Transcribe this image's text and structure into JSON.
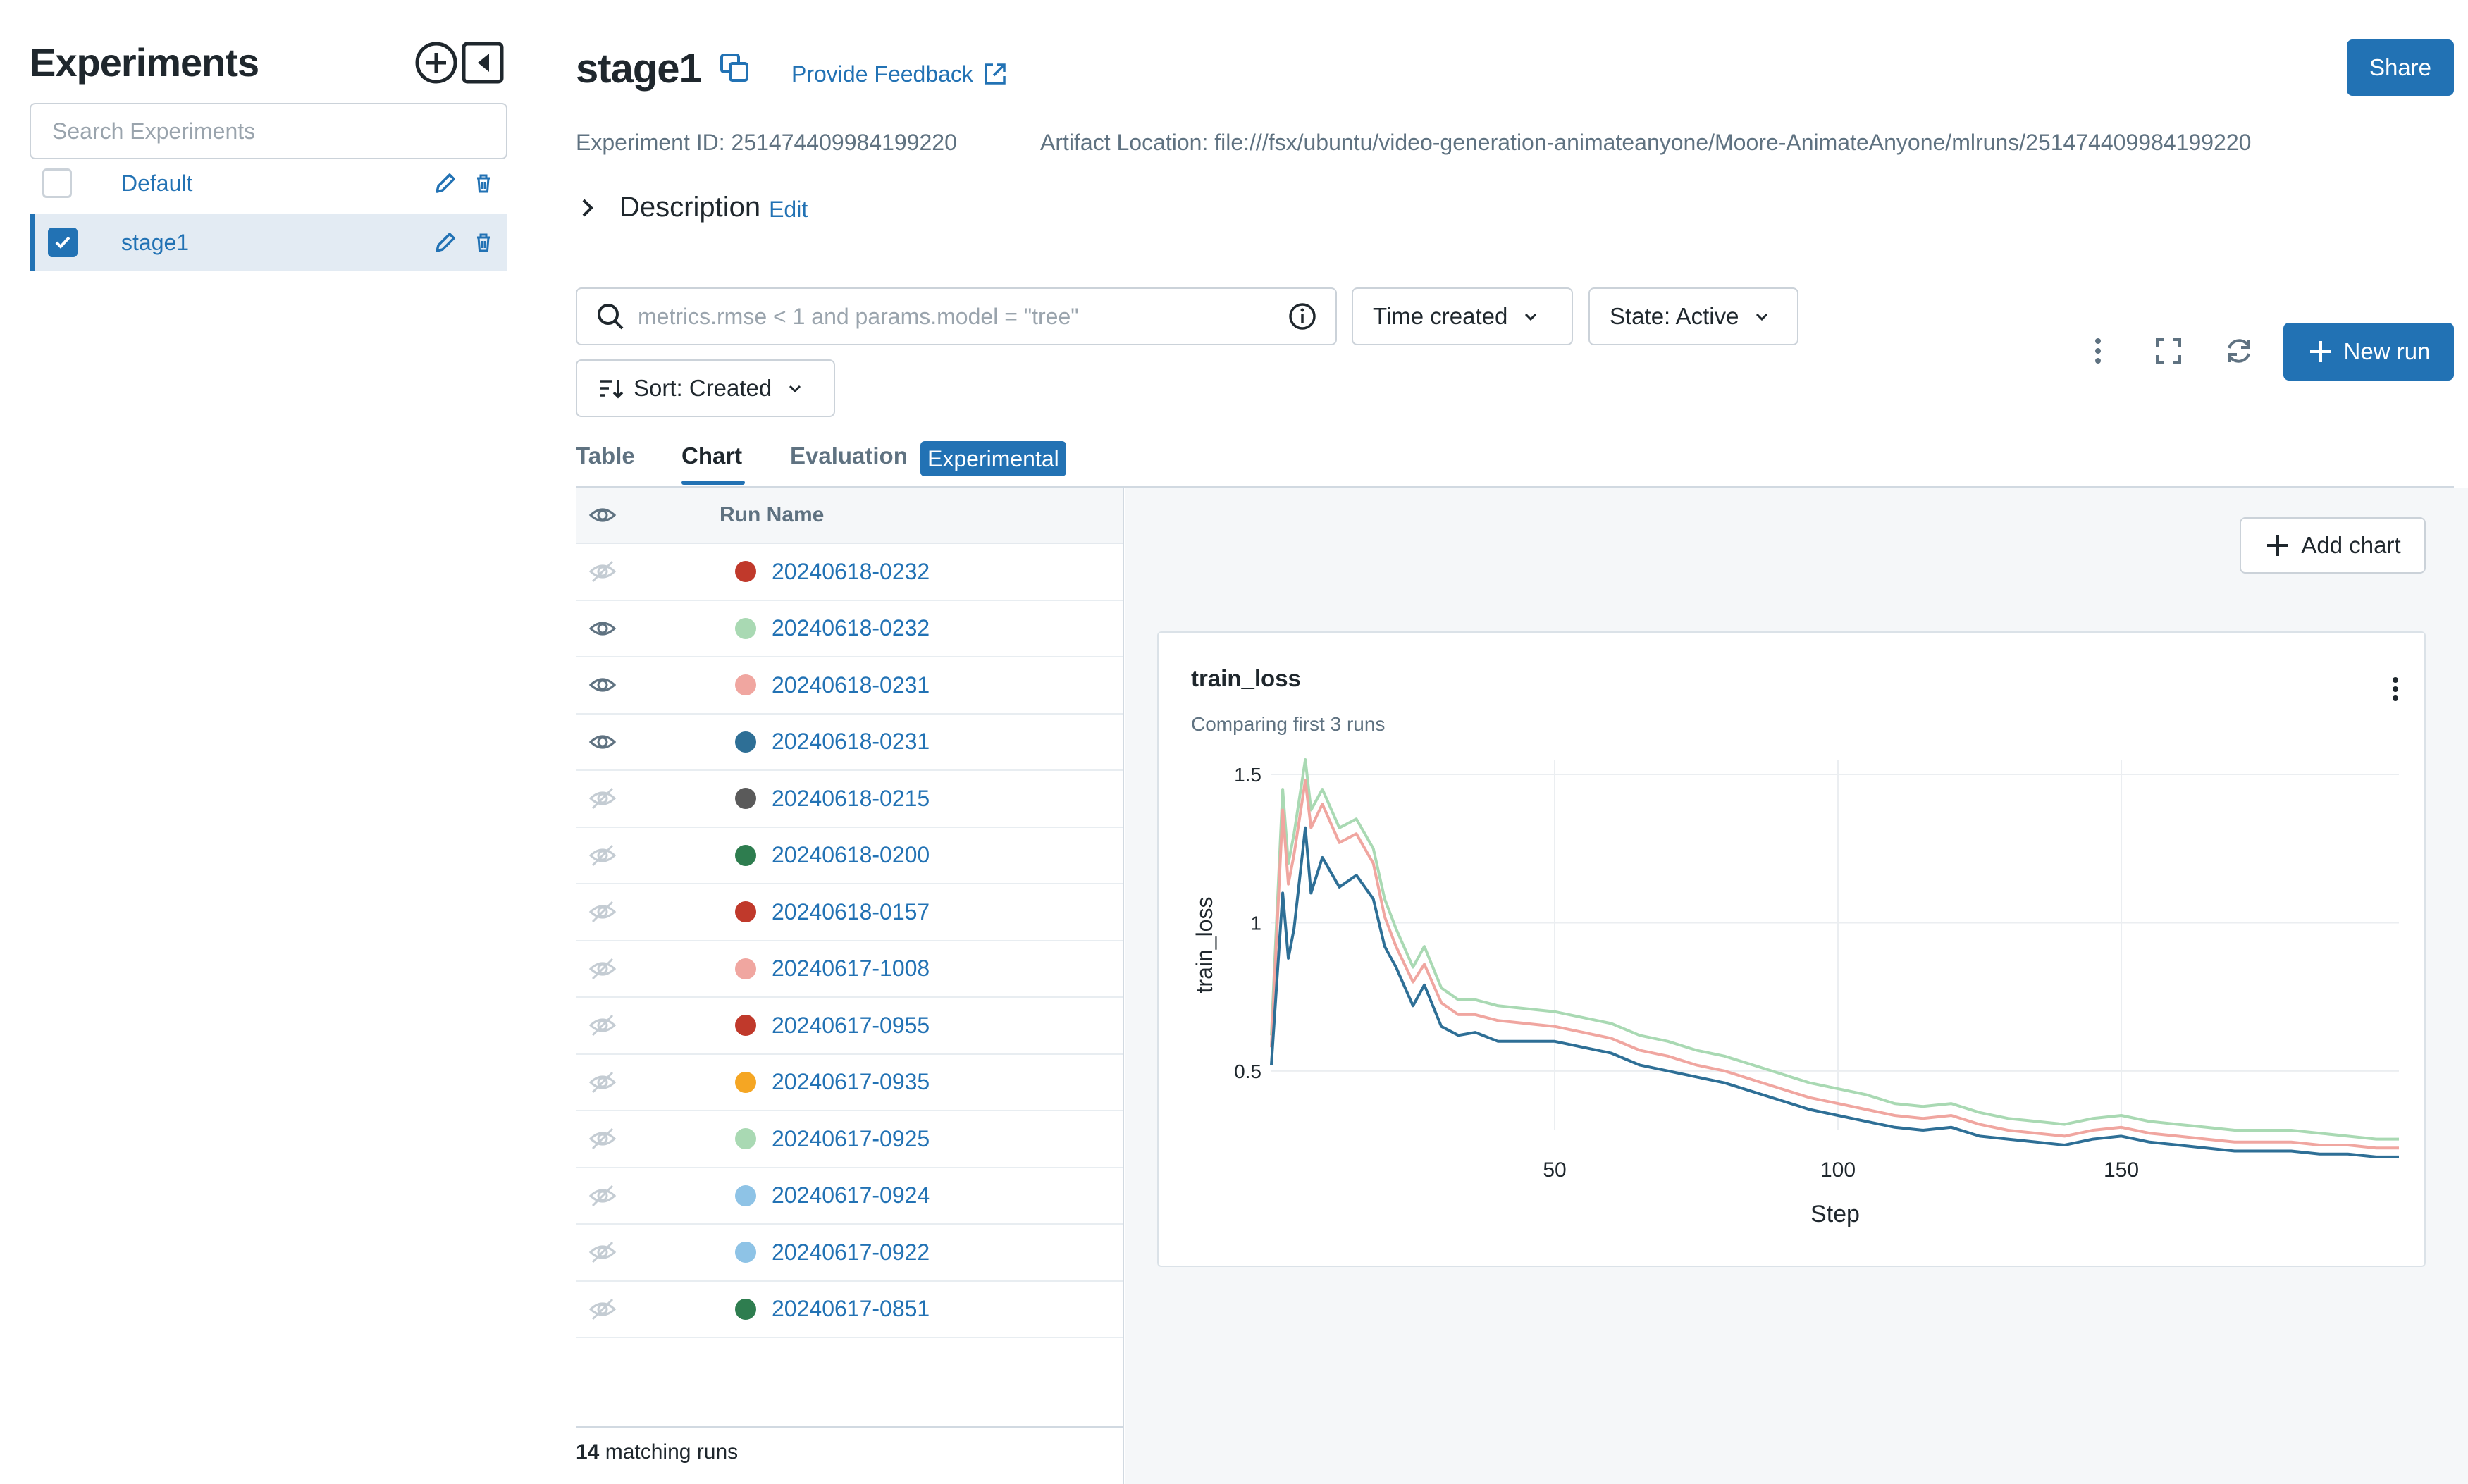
{
  "sidebar": {
    "title": "Experiments",
    "search_placeholder": "Search Experiments",
    "items": [
      {
        "label": "Default",
        "checked": false
      },
      {
        "label": "stage1",
        "checked": true
      }
    ]
  },
  "header": {
    "title": "stage1",
    "feedback": "Provide Feedback",
    "share": "Share",
    "experiment_id": "Experiment ID: 251474409984199220",
    "artifact_location": "Artifact Location: file:///fsx/ubuntu/video-generation-animateanyone/Moore-AnimateAnyone/mlruns/251474409984199220",
    "description": "Description",
    "edit": "Edit"
  },
  "controls": {
    "search_placeholder": "metrics.rmse < 1 and params.model = \"tree\"",
    "time_created": "Time created",
    "state": "State: Active",
    "sort": "Sort: Created",
    "new_run": "New run"
  },
  "tabs": {
    "table": "Table",
    "chart": "Chart",
    "evaluation": "Evaluation",
    "experimental": "Experimental"
  },
  "runs": {
    "header": "Run Name",
    "rows": [
      {
        "name": "20240618-0232",
        "color": "#c0392b",
        "visible": false
      },
      {
        "name": "20240618-0232",
        "color": "#a9d9b3",
        "visible": true
      },
      {
        "name": "20240618-0231",
        "color": "#f0a6a0",
        "visible": true
      },
      {
        "name": "20240618-0231",
        "color": "#2e6f96",
        "visible": true
      },
      {
        "name": "20240618-0215",
        "color": "#5a5a5a",
        "visible": false
      },
      {
        "name": "20240618-0200",
        "color": "#2e7d4f",
        "visible": false
      },
      {
        "name": "20240618-0157",
        "color": "#c0392b",
        "visible": false
      },
      {
        "name": "20240617-1008",
        "color": "#f0a6a0",
        "visible": false
      },
      {
        "name": "20240617-0955",
        "color": "#c0392b",
        "visible": false
      },
      {
        "name": "20240617-0935",
        "color": "#f5a623",
        "visible": false
      },
      {
        "name": "20240617-0925",
        "color": "#a9d9b3",
        "visible": false
      },
      {
        "name": "20240617-0924",
        "color": "#8ec3e6",
        "visible": false
      },
      {
        "name": "20240617-0922",
        "color": "#8ec3e6",
        "visible": false
      },
      {
        "name": "20240617-0851",
        "color": "#2e7d4f",
        "visible": false
      }
    ],
    "count": "14",
    "count_suffix": " matching runs"
  },
  "chart_panel": {
    "add_chart": "Add chart",
    "card_title": "train_loss",
    "card_subtitle": "Comparing first 3 runs"
  },
  "chart_data": {
    "type": "line",
    "title": "train_loss",
    "xlabel": "Step",
    "ylabel": "train_loss",
    "xlim": [
      0,
      199
    ],
    "ylim": [
      0.3,
      1.55
    ],
    "xticks": [
      50,
      100,
      150
    ],
    "yticks": [
      0.5,
      1,
      1.5
    ],
    "grid": true,
    "series": [
      {
        "color": "#a9d9b3",
        "points": [
          [
            0,
            0.62
          ],
          [
            2,
            1.45
          ],
          [
            3,
            1.2
          ],
          [
            4,
            1.3
          ],
          [
            6,
            1.55
          ],
          [
            7,
            1.38
          ],
          [
            9,
            1.45
          ],
          [
            12,
            1.32
          ],
          [
            15,
            1.35
          ],
          [
            18,
            1.25
          ],
          [
            20,
            1.08
          ],
          [
            22,
            0.98
          ],
          [
            25,
            0.85
          ],
          [
            27,
            0.92
          ],
          [
            30,
            0.78
          ],
          [
            33,
            0.74
          ],
          [
            36,
            0.74
          ],
          [
            40,
            0.72
          ],
          [
            45,
            0.71
          ],
          [
            50,
            0.7
          ],
          [
            55,
            0.68
          ],
          [
            60,
            0.66
          ],
          [
            65,
            0.62
          ],
          [
            70,
            0.6
          ],
          [
            75,
            0.57
          ],
          [
            80,
            0.55
          ],
          [
            85,
            0.52
          ],
          [
            90,
            0.49
          ],
          [
            95,
            0.46
          ],
          [
            100,
            0.44
          ],
          [
            105,
            0.42
          ],
          [
            110,
            0.39
          ],
          [
            115,
            0.38
          ],
          [
            120,
            0.39
          ],
          [
            125,
            0.36
          ],
          [
            130,
            0.34
          ],
          [
            135,
            0.33
          ],
          [
            140,
            0.32
          ],
          [
            145,
            0.34
          ],
          [
            150,
            0.35
          ],
          [
            155,
            0.33
          ],
          [
            160,
            0.32
          ],
          [
            165,
            0.31
          ],
          [
            170,
            0.3
          ],
          [
            175,
            0.3
          ],
          [
            180,
            0.3
          ],
          [
            185,
            0.29
          ],
          [
            190,
            0.28
          ],
          [
            195,
            0.27
          ],
          [
            199,
            0.27
          ]
        ]
      },
      {
        "color": "#f0a6a0",
        "points": [
          [
            0,
            0.58
          ],
          [
            2,
            1.38
          ],
          [
            3,
            1.13
          ],
          [
            4,
            1.23
          ],
          [
            6,
            1.48
          ],
          [
            7,
            1.32
          ],
          [
            9,
            1.4
          ],
          [
            12,
            1.27
          ],
          [
            15,
            1.3
          ],
          [
            18,
            1.2
          ],
          [
            20,
            1.02
          ],
          [
            22,
            0.92
          ],
          [
            25,
            0.8
          ],
          [
            27,
            0.86
          ],
          [
            30,
            0.73
          ],
          [
            33,
            0.69
          ],
          [
            36,
            0.69
          ],
          [
            40,
            0.67
          ],
          [
            45,
            0.66
          ],
          [
            50,
            0.65
          ],
          [
            55,
            0.63
          ],
          [
            60,
            0.61
          ],
          [
            65,
            0.57
          ],
          [
            70,
            0.55
          ],
          [
            75,
            0.52
          ],
          [
            80,
            0.5
          ],
          [
            85,
            0.47
          ],
          [
            90,
            0.44
          ],
          [
            95,
            0.41
          ],
          [
            100,
            0.39
          ],
          [
            105,
            0.37
          ],
          [
            110,
            0.35
          ],
          [
            115,
            0.34
          ],
          [
            120,
            0.35
          ],
          [
            125,
            0.32
          ],
          [
            130,
            0.3
          ],
          [
            135,
            0.29
          ],
          [
            140,
            0.28
          ],
          [
            145,
            0.3
          ],
          [
            150,
            0.31
          ],
          [
            155,
            0.29
          ],
          [
            160,
            0.28
          ],
          [
            165,
            0.27
          ],
          [
            170,
            0.26
          ],
          [
            175,
            0.26
          ],
          [
            180,
            0.26
          ],
          [
            185,
            0.25
          ],
          [
            190,
            0.25
          ],
          [
            195,
            0.24
          ],
          [
            199,
            0.24
          ]
        ]
      },
      {
        "color": "#2e6f96",
        "points": [
          [
            0,
            0.52
          ],
          [
            2,
            1.1
          ],
          [
            3,
            0.88
          ],
          [
            4,
            0.98
          ],
          [
            6,
            1.32
          ],
          [
            7,
            1.1
          ],
          [
            9,
            1.22
          ],
          [
            12,
            1.12
          ],
          [
            15,
            1.16
          ],
          [
            18,
            1.08
          ],
          [
            20,
            0.92
          ],
          [
            22,
            0.85
          ],
          [
            25,
            0.72
          ],
          [
            27,
            0.79
          ],
          [
            30,
            0.65
          ],
          [
            33,
            0.62
          ],
          [
            36,
            0.63
          ],
          [
            40,
            0.6
          ],
          [
            45,
            0.6
          ],
          [
            50,
            0.6
          ],
          [
            55,
            0.58
          ],
          [
            60,
            0.56
          ],
          [
            65,
            0.52
          ],
          [
            70,
            0.5
          ],
          [
            75,
            0.48
          ],
          [
            80,
            0.46
          ],
          [
            85,
            0.43
          ],
          [
            90,
            0.4
          ],
          [
            95,
            0.37
          ],
          [
            100,
            0.35
          ],
          [
            105,
            0.33
          ],
          [
            110,
            0.31
          ],
          [
            115,
            0.3
          ],
          [
            120,
            0.31
          ],
          [
            125,
            0.28
          ],
          [
            130,
            0.27
          ],
          [
            135,
            0.26
          ],
          [
            140,
            0.25
          ],
          [
            145,
            0.27
          ],
          [
            150,
            0.28
          ],
          [
            155,
            0.26
          ],
          [
            160,
            0.25
          ],
          [
            165,
            0.24
          ],
          [
            170,
            0.23
          ],
          [
            175,
            0.23
          ],
          [
            180,
            0.23
          ],
          [
            185,
            0.22
          ],
          [
            190,
            0.22
          ],
          [
            195,
            0.21
          ],
          [
            199,
            0.21
          ]
        ]
      }
    ]
  }
}
